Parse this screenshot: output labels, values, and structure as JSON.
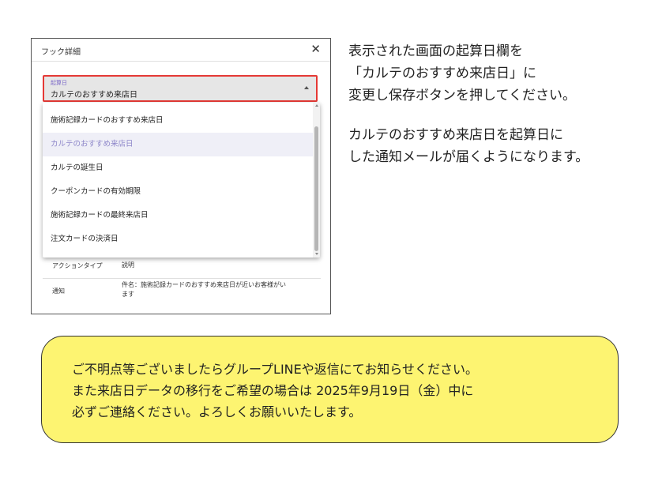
{
  "dialog": {
    "title": "フック詳細",
    "close_glyph": "✕",
    "select": {
      "label": "起算日",
      "value": "カルテのおすすめ来店日"
    },
    "dropdown": {
      "options": [
        "施術記録カードのおすすめ来店日",
        "カルテのおすすめ来店日",
        "カルテの誕生日",
        "クーポンカードの有効期限",
        "施術記録カードの最終来店日",
        "注文カードの決済日"
      ],
      "selected_index": 1
    },
    "rows": {
      "row1_label": "アクションタイプ",
      "row1_value": "説明",
      "row2_label": "通知",
      "row2_value_line1": "件名：施術記録カードのおすすめ来店日が近いお客様がい",
      "row2_value_line2": "ます"
    }
  },
  "instructions": {
    "line1": "表示された画面の起算日欄を",
    "line2": "「カルテのおすすめ来店日」に",
    "line3": "変更し保存ボタンを押してください。",
    "line4": "カルテのおすすめ来店日を起算日に",
    "line5": "した通知メールが届くようになります。"
  },
  "notice": {
    "line1": "ご不明点等ございましたらグループLINEや返信にてお知らせください。",
    "line2": "また来店日データの移行をご希望の場合は 2025年9月19日（金）中に",
    "line3": "必ずご連絡ください。よろしくお願いいたします。"
  },
  "colors": {
    "highlight_border": "#e53935",
    "notice_background": "#fdf471",
    "selected_option_text": "#8d86c9",
    "field_label": "#7b68c8"
  }
}
